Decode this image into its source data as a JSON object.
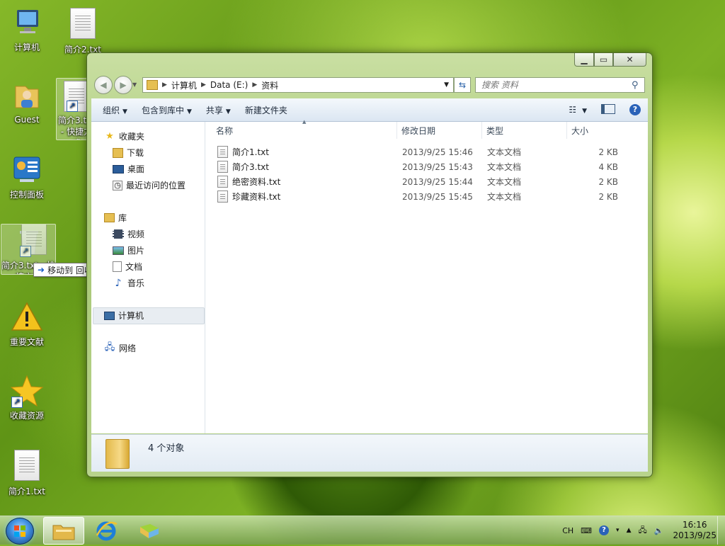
{
  "desktop": {
    "icons": [
      {
        "label": "计算机"
      },
      {
        "label": "简介2.txt"
      },
      {
        "label": "Guest"
      },
      {
        "label": "简介3.txt - 快捷方式"
      },
      {
        "label": "控制面板"
      },
      {
        "label": "简介3.txt - 快捷方式"
      },
      {
        "label": "重要文献"
      },
      {
        "label": "收藏资源"
      },
      {
        "label": "简介1.txt"
      }
    ],
    "drag_tooltip": "移动到 回收站"
  },
  "explorer": {
    "address": {
      "crumbs": [
        "计算机",
        "Data (E:)",
        "资料"
      ]
    },
    "search_placeholder": "搜索 资料",
    "toolbar": {
      "organize": "组织",
      "include": "包含到库中",
      "share": "共享",
      "new_folder": "新建文件夹"
    },
    "nav": {
      "favorites": "收藏夹",
      "downloads": "下载",
      "desktop": "桌面",
      "recent": "最近访问的位置",
      "libraries": "库",
      "videos": "视频",
      "pictures": "图片",
      "documents": "文档",
      "music": "音乐",
      "computer": "计算机",
      "network": "网络"
    },
    "columns": {
      "name": "名称",
      "modified": "修改日期",
      "type": "类型",
      "size": "大小"
    },
    "files": [
      {
        "name": "简介1.txt",
        "modified": "2013/9/25 15:46",
        "type": "文本文档",
        "size": "2 KB"
      },
      {
        "name": "简介3.txt",
        "modified": "2013/9/25 15:43",
        "type": "文本文档",
        "size": "4 KB"
      },
      {
        "name": "绝密资料.txt",
        "modified": "2013/9/25 15:44",
        "type": "文本文档",
        "size": "2 KB"
      },
      {
        "name": "珍藏资料.txt",
        "modified": "2013/9/25 15:45",
        "type": "文本文档",
        "size": "2 KB"
      }
    ],
    "status": "4 个对象"
  },
  "taskbar": {
    "ime": "CH",
    "time": "16:16",
    "date": "2013/9/25"
  }
}
